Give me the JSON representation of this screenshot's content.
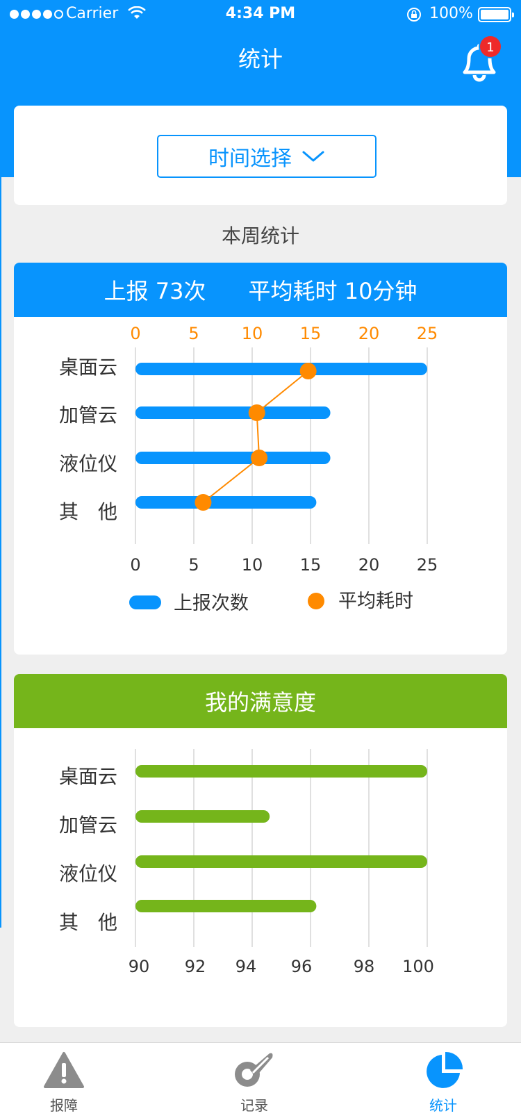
{
  "status_bar": {
    "carrier": "Carrier",
    "time": "4:34 PM",
    "battery": "100%"
  },
  "header": {
    "title": "统计",
    "notification_count": "1"
  },
  "filter": {
    "time_select_label": "时间选择"
  },
  "week": {
    "title": "本周统计",
    "summary": {
      "report_label": "上报",
      "report_value": "73次",
      "avg_label": "平均耗时",
      "avg_value": "10分钟"
    }
  },
  "satisfaction": {
    "title": "我的满意度"
  },
  "tabbar": {
    "items": [
      {
        "label": "报障",
        "icon": "warning-icon",
        "active": false
      },
      {
        "label": "记录",
        "icon": "record-icon",
        "active": false
      },
      {
        "label": "统计",
        "icon": "pie-chart-icon",
        "active": true
      }
    ]
  },
  "colors": {
    "primary": "#0894fd",
    "orange": "#ff8a00",
    "green": "#75b51b",
    "badge": "#ee2a2a"
  },
  "chart_data": [
    {
      "type": "bar",
      "orientation": "horizontal",
      "categories": [
        "桌面云",
        "加管云",
        "液位仪",
        "其　他"
      ],
      "x_ticks": [
        "0",
        "5",
        "10",
        "15",
        "20",
        "25"
      ],
      "xlim": [
        0,
        25
      ],
      "top_axis_ticks": [
        "0",
        "5",
        "10",
        "15",
        "20",
        "25"
      ],
      "series": [
        {
          "name": "上报次数",
          "type": "bar",
          "color": "#0894fd",
          "values": [
            25,
            16.7,
            16.7,
            15.5
          ]
        },
        {
          "name": "平均耗时",
          "type": "line",
          "color": "#ff8a00",
          "values": [
            14.8,
            10.4,
            10.6,
            5.8
          ]
        }
      ],
      "legend": [
        "上报次数",
        "平均耗时"
      ],
      "grid": true
    },
    {
      "type": "bar",
      "orientation": "horizontal",
      "categories": [
        "桌面云",
        "加管云",
        "液位仪",
        "其　他"
      ],
      "x_ticks": [
        "90",
        "92",
        "94",
        "96",
        "98",
        "100"
      ],
      "xlim": [
        90,
        100
      ],
      "series": [
        {
          "color": "#75b51b",
          "values": [
            100,
            94.6,
            100,
            96.2
          ]
        }
      ],
      "grid": true
    }
  ]
}
